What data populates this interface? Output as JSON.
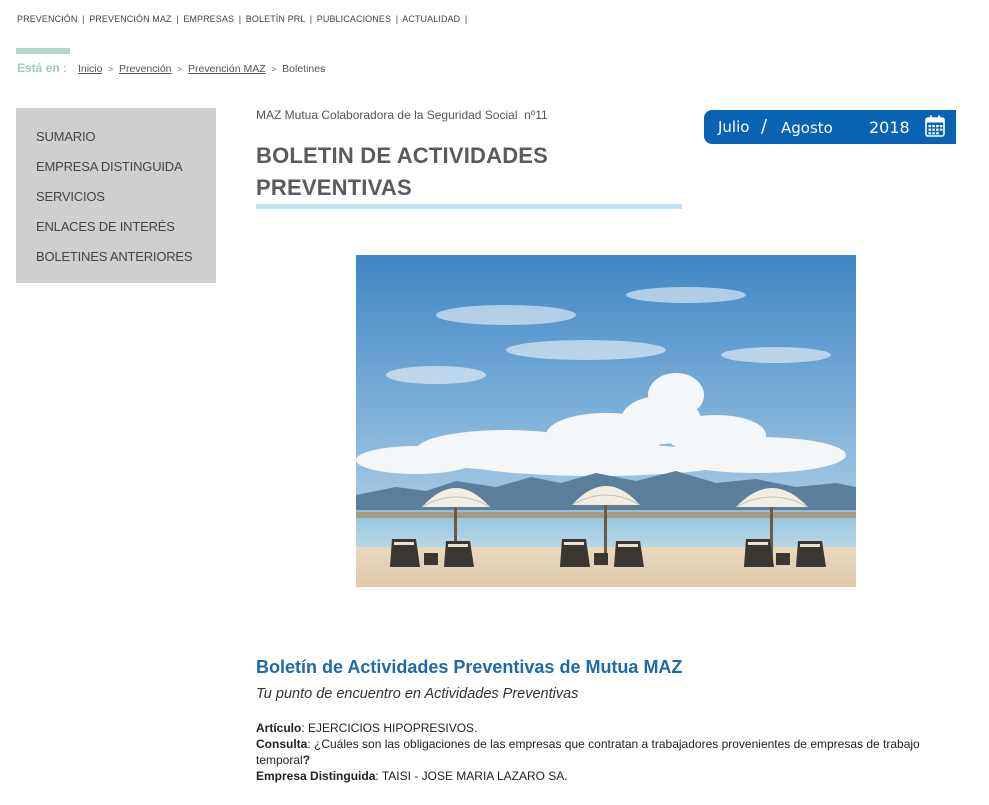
{
  "topnav": {
    "items": [
      "PREVENCIÓN",
      "PREVENCIÓN MAZ",
      "EMPRESAS",
      "BOLETÍN PRL",
      "PUBLICACIONES",
      "ACTUALIDAD"
    ],
    "separator": "|"
  },
  "breadcrumb": {
    "label": "Está en :",
    "items": [
      "Inicio",
      "Prevención",
      "Prevención MAZ"
    ],
    "current": "Boletines",
    "arrow": ">"
  },
  "sidebar": {
    "items": [
      "SUMARIO",
      "EMPRESA DISTINGUIDA",
      "SERVICIOS",
      "ENLACES DE INTERÉS",
      "BOLETINES ANTERIORES"
    ]
  },
  "header": {
    "subtitle": "MAZ Mutua Colaboradora de la Seguridad Social  nº11",
    "title": "BOLETIN DE ACTIVIDADES PREVENTIVAS"
  },
  "date_badge": {
    "month1": "Julio",
    "slash": "/",
    "month2": "Agosto",
    "year": "2018",
    "icon": "calendar-icon",
    "color": "#0863b4"
  },
  "hero": {
    "icon": "beach-umbrellas-photo"
  },
  "content": {
    "heading": "Boletín de Actividades Preventivas de Mutua MAZ",
    "tagline": "Tu punto de encuentro en Actividades Preventivas",
    "articulo_label": "Artículo",
    "articulo_text": ": EJERCICIOS HIPOPRESIVOS.",
    "consulta_label": "Consulta",
    "consulta_text": ": ¿Cuáles son las obligaciones de las empresas que contratan a trabajadores provenientes de empresas de trabajo temporal",
    "consulta_end": "?",
    "empresa_label": "Empresa Distinguida",
    "empresa_text": ": TAISI - JOSE MARIA LAZARO SA."
  },
  "colors": {
    "heading_blue": "#1e6aa8",
    "sidebar_bg": "#cfcfcf",
    "title_underline": "#bde3f2",
    "breadcrumb_accent": "#9dcdc0"
  }
}
